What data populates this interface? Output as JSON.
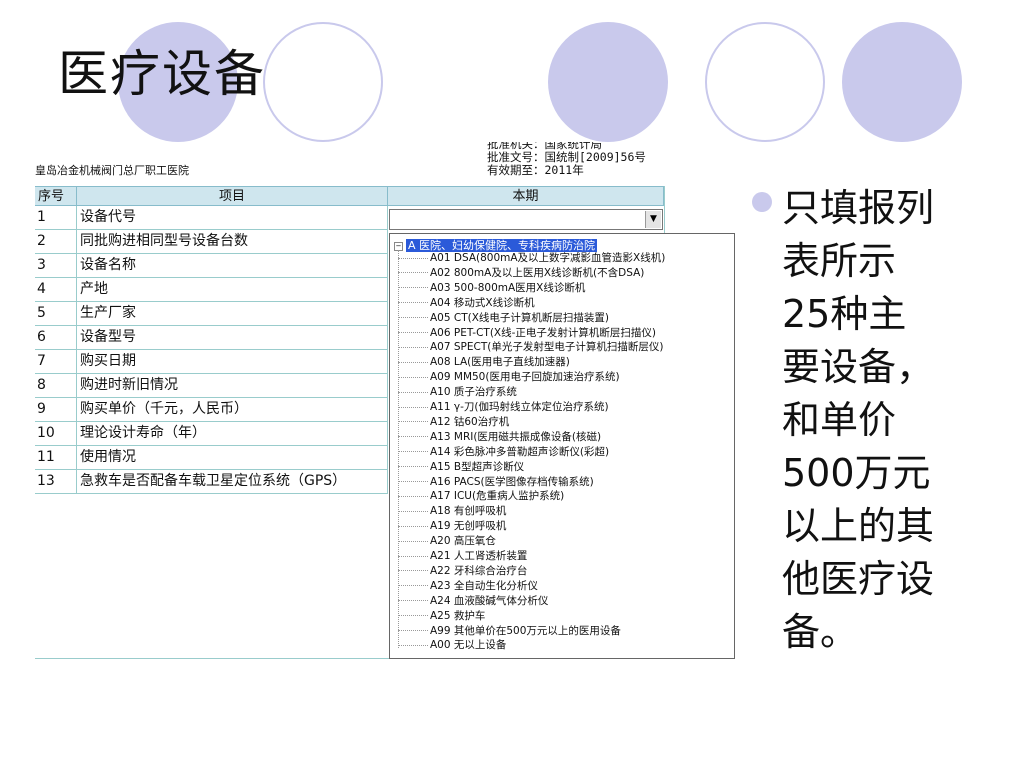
{
  "slide": {
    "title": "医疗设备",
    "note": "只填报列表所示25种主要设备，和单价500万元以上的其他医疗设备。",
    "note_lines": [
      "只填报列",
      "表所示",
      "25种主",
      "要设备，",
      "和单价",
      "500万元",
      "以上的其",
      "他医疗设",
      "备。"
    ],
    "accent_color": "#c9c9ec"
  },
  "form": {
    "unit_name": "皇岛冶金机械阀门总厂职工医院",
    "approval": [
      "批准机关：国家统计局",
      "批准文号：国统制[2009]56号",
      "有效期至：2011年"
    ],
    "headers": {
      "seq": "序号",
      "item": "项目",
      "period": "本期"
    },
    "rows": [
      {
        "seq": "1",
        "item": "设备代号"
      },
      {
        "seq": "2",
        "item": "同批购进相同型号设备台数"
      },
      {
        "seq": "3",
        "item": "设备名称"
      },
      {
        "seq": "4",
        "item": "产地"
      },
      {
        "seq": "5",
        "item": "生产厂家"
      },
      {
        "seq": "6",
        "item": "设备型号"
      },
      {
        "seq": "7",
        "item": "购买日期"
      },
      {
        "seq": "8",
        "item": "购进时新旧情况"
      },
      {
        "seq": "9",
        "item": "购买单价（千元，人民币）"
      },
      {
        "seq": "10",
        "item": "理论设计寿命（年）"
      },
      {
        "seq": "11",
        "item": "使用情况"
      },
      {
        "seq": "13",
        "item": "急救车是否配备车载卫星定位系统（GPS）"
      }
    ],
    "dropdown": {
      "root_label": "A 医院、妇幼保健院、专科疾病防治院",
      "items": [
        "A01 DSA(800mA及以上数字减影血管造影X线机)",
        "A02 800mA及以上医用X线诊断机(不含DSA)",
        "A03 500-800mA医用X线诊断机",
        "A04 移动式X线诊断机",
        "A05 CT(X线电子计算机断层扫描装置)",
        "A06 PET-CT(X线-正电子发射计算机断层扫描仪)",
        "A07 SPECT(单光子发射型电子计算机扫描断层仪)",
        "A08 LA(医用电子直线加速器)",
        "A09 MM50(医用电子回旋加速治疗系统)",
        "A10 质子治疗系统",
        "A11 γ-刀(伽玛射线立体定位治疗系统)",
        "A12 钴60治疗机",
        "A13 MRI(医用磁共振成像设备(核磁)",
        "A14 彩色脉冲多普勒超声诊断仪(彩超)",
        "A15 B型超声诊断仪",
        "A16 PACS(医学图像存档传输系统)",
        "A17 ICU(危重病人监护系统)",
        "A18 有创呼吸机",
        "A19 无创呼吸机",
        "A20 高压氧仓",
        "A21 人工肾透析装置",
        "A22 牙科综合治疗台",
        "A23 全自动生化分析仪",
        "A24 血液酸碱气体分析仪",
        "A25 救护车",
        "A99 其他单价在500万元以上的医用设备",
        "A00 无以上设备"
      ]
    }
  }
}
